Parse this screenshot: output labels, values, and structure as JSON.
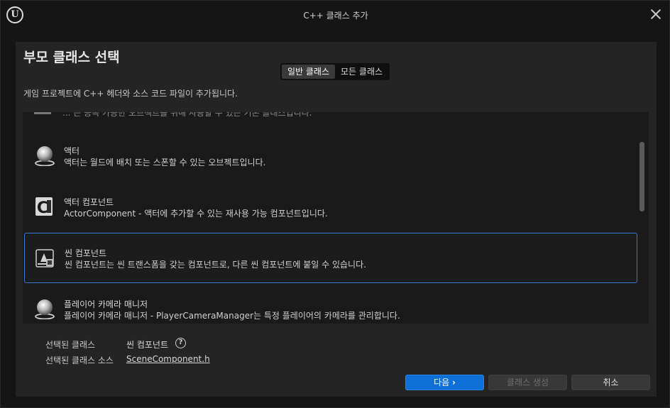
{
  "window": {
    "title": "C++ 클래스 추가",
    "logo_icon": "unreal-engine-logo-icon",
    "logo_text": "U",
    "close_icon": "close-icon"
  },
  "dialog": {
    "heading": "부모 클래스 선택",
    "tabs": [
      {
        "label": "일반 클래스",
        "active": true
      },
      {
        "label": "모든 클래스",
        "active": false
      }
    ],
    "description": "게임 프로젝트에 C++ 헤더와 소스 코드 파일이 추가됩니다."
  },
  "class_list": {
    "partial_item_text": "... 는 증폭 가능한 오브젝트를 위해 사용할 수 있는 기본 클래스입니다.",
    "items": [
      {
        "title": "액터",
        "subtitle": "액터는 월드에 배치 또는 스폰할 수 있는 오브젝트입니다.",
        "icon": "actor-sphere-icon",
        "selected": false
      },
      {
        "title": "액터 컴포넌트",
        "subtitle": "ActorComponent - 액터에 추가할 수 있는 재사용 가능 컴포넌트입니다.",
        "icon": "actor-component-icon",
        "selected": false
      },
      {
        "title": "씬 컴포넌트",
        "subtitle": "씬 컴포넌트는 씬 트랜스폼을 갖는 컴포넌트로, 다른 씬 컴포넌트에 붙일 수 있습니다.",
        "icon": "scene-component-icon",
        "selected": true
      },
      {
        "title": "플레이어 카메라 매니저",
        "subtitle": "플레이어 카메라 매니저 - PlayerCameraManager는 특정 플레이어의 카메라를 관리합니다.",
        "icon": "player-camera-manager-sphere-icon",
        "selected": false
      }
    ]
  },
  "selection": {
    "class_label": "선택된 클래스",
    "class_value": "씬 컴포넌트",
    "help_icon": "help-icon",
    "help_glyph": "?",
    "source_label": "선택된 클래스 소스",
    "source_value": "SceneComponent.h"
  },
  "buttons": {
    "next_label": "다음",
    "next_icon": "chevron-right-icon",
    "next_glyph": "›",
    "create_label": "클래스 생성",
    "cancel_label": "취소"
  },
  "colors": {
    "accent": "#0e6fd9",
    "selection_border": "#3a78d0",
    "panel": "#242424",
    "background": "#151515"
  }
}
